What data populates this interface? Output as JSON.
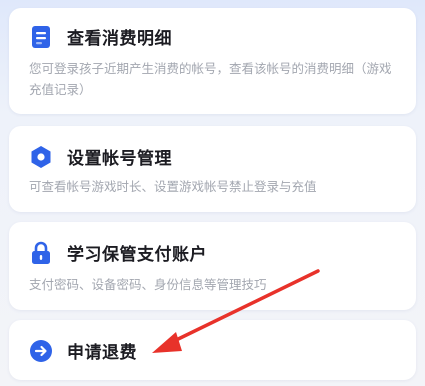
{
  "items": [
    {
      "title": "查看消费明细",
      "desc": "您可登录孩子近期产生消费的帐号，查看该帐号的消费明细（游戏充值记录）",
      "icon": "document-icon"
    },
    {
      "title": "设置帐号管理",
      "desc": "可查看帐号游戏时长、设置游戏帐号禁止登录与充值",
      "icon": "hexagon-settings-icon"
    },
    {
      "title": "学习保管支付账户",
      "desc": "支付密码、设备密码、身份信息等管理技巧",
      "icon": "lock-icon"
    },
    {
      "title": "申请退费",
      "icon": "arrow-right-circle-icon"
    }
  ],
  "accent_color": "#2f63e8",
  "annotation_arrow_color": "#e8322a"
}
